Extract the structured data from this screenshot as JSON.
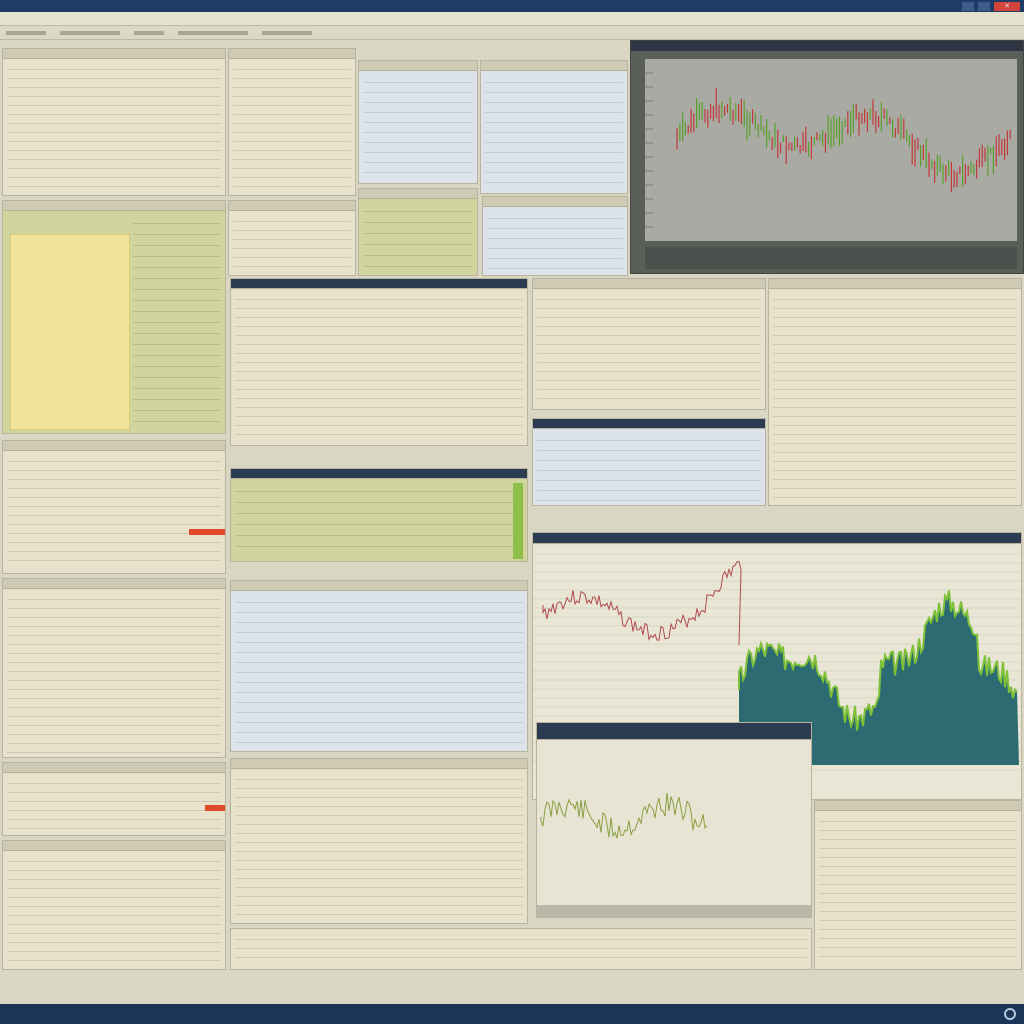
{
  "window": {
    "title": "",
    "controls": [
      "",
      "",
      "✕"
    ]
  },
  "colors": {
    "accent": "#1f3c66",
    "panel": "#e8e2cd",
    "highlight_yellow": "#f1e39a",
    "highlight_green": "#cfd59c",
    "candle_up": "#5aa02c",
    "candle_down": "#c23a3a",
    "area_fill": "#2c6b72",
    "area_top": "#7fc23a"
  },
  "yellow_note": {
    "lines": [
      "",
      "",
      "",
      "",
      "",
      "",
      "",
      "",
      "",
      "",
      "",
      "",
      ""
    ]
  },
  "statusbar": {
    "left": "",
    "right": ""
  },
  "icons": {
    "window_min": "minimize-icon",
    "window_max": "maximize-icon",
    "window_close": "close-icon",
    "clock": "clock-icon"
  }
}
